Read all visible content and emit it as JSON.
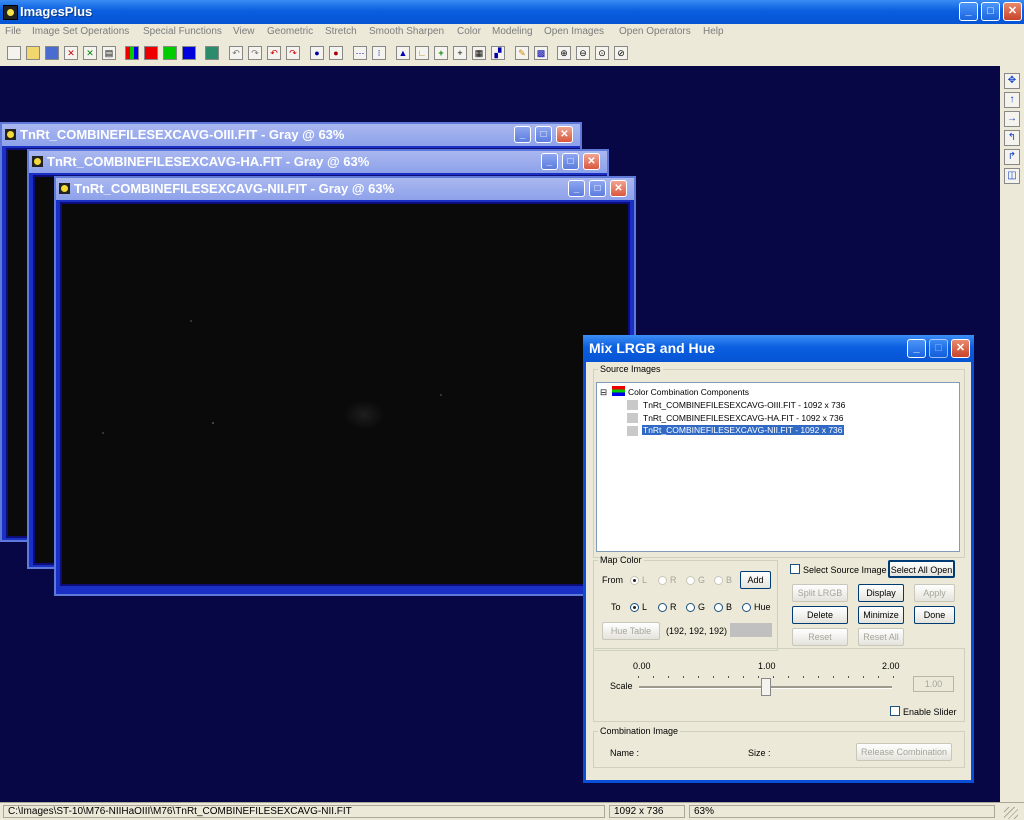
{
  "app": {
    "title": "ImagesPlus"
  },
  "menu": [
    "File",
    "Image Set Operations",
    "Special Functions",
    "View",
    "Geometric",
    "Stretch",
    "Smooth Sharpen",
    "Color",
    "Modeling",
    "Open Images",
    "Open Operators",
    "Help"
  ],
  "windows": [
    {
      "title": "TnRt_COMBINEFILESEXCAVG-OIII.FIT - Gray @ 63%"
    },
    {
      "title": "TnRt_COMBINEFILESEXCAVG-HA.FIT - Gray @ 63%"
    },
    {
      "title": "TnRt_COMBINEFILESEXCAVG-NII.FIT - Gray @ 63%"
    }
  ],
  "dialog": {
    "title": "Mix LRGB and Hue",
    "source_images_label": "Source Images",
    "tree_root": "Color Combination Components",
    "tree_items": [
      "TnRt_COMBINEFILESEXCAVG-OIII.FIT - 1092 x 736",
      "TnRt_COMBINEFILESEXCAVG-HA.FIT - 1092 x 736",
      "TnRt_COMBINEFILESEXCAVG-NII.FIT - 1092 x 736"
    ],
    "map_color_label": "Map Color",
    "from_label": "From",
    "to_label": "To",
    "from_options": [
      "L",
      "R",
      "G",
      "B"
    ],
    "to_options": [
      "L",
      "R",
      "G",
      "B",
      "Hue"
    ],
    "add_label": "Add",
    "hue_table_label": "Hue Table",
    "rgb_value": "(192, 192, 192)",
    "select_source_label": "Select Source Image",
    "select_all_open_label": "Select All Open",
    "split_lrgb_label": "Split LRGB",
    "display_label": "Display",
    "apply_label": "Apply",
    "delete_label": "Delete",
    "minimize_label": "Minimize",
    "done_label": "Done",
    "reset_label": "Reset",
    "reset_all_label": "Reset All",
    "scale_label": "Scale",
    "scale_min": "0.00",
    "scale_mid": "1.00",
    "scale_max": "2.00",
    "scale_value": "1.00",
    "enable_slider_label": "Enable Slider",
    "combination_image_label": "Combination Image",
    "name_label": "Name :",
    "size_label": "Size :",
    "release_combination_label": "Release Combination"
  },
  "status": {
    "path": "C:\\Images\\ST-10\\M76-NIIHaOIII\\M76\\TnRt_COMBINEFILESEXCAVG-NII.FIT",
    "dimensions": "1092 x 736",
    "zoom": "63%"
  },
  "colors": {
    "accent": "#0a5fe0",
    "workspace": "#070745"
  }
}
